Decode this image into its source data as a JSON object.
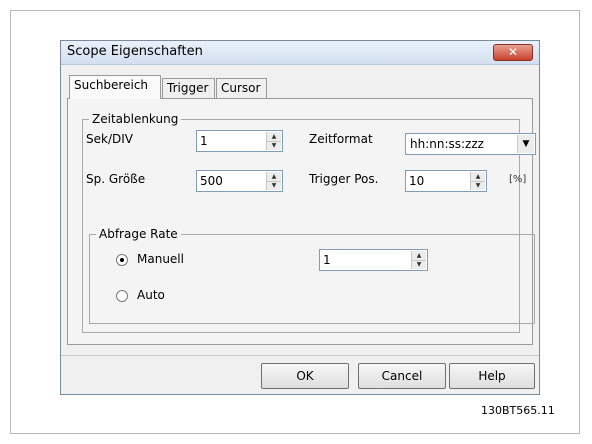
{
  "dialog": {
    "title": "Scope Eigenschaften",
    "close_symbol": "✕"
  },
  "tabs": [
    {
      "label": "Suchbereich",
      "active": true
    },
    {
      "label": "Trigger",
      "active": false
    },
    {
      "label": "Cursor",
      "active": false
    }
  ],
  "zeitablenkung": {
    "legend": "Zeitablenkung",
    "sek_div_label": "Sek/DIV",
    "sek_div_value": "1",
    "zeitformat_label": "Zeitformat",
    "zeitformat_value": "hh:nn:ss:zzz",
    "sp_groesse_label": "Sp. Größe",
    "sp_groesse_value": "500",
    "trigger_pos_label": "Trigger Pos.",
    "trigger_pos_value": "10",
    "trigger_pos_unit": "[%]"
  },
  "abfrage_rate": {
    "legend": "Abfrage Rate",
    "manuell_label": "Manuell",
    "manuell_selected": true,
    "manuell_value": "1",
    "auto_label": "Auto",
    "auto_selected": false
  },
  "buttons": {
    "ok": "OK",
    "cancel": "Cancel",
    "help": "Help"
  },
  "figure_code": "130BT565.11",
  "spinner_glyphs": {
    "up": "▲",
    "down": "▼"
  },
  "dropdown_glyph": "▼"
}
